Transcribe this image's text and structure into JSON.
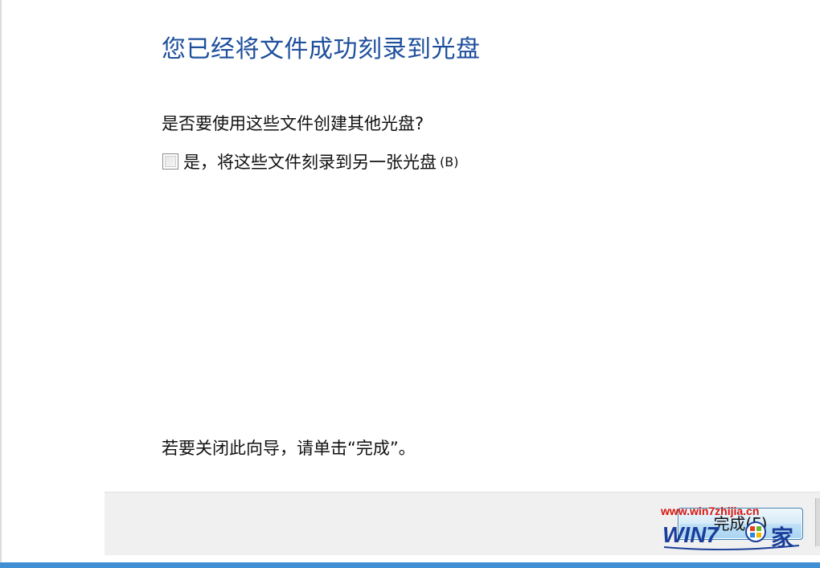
{
  "wizard": {
    "heading": "您已经将文件成功刻录到光盘",
    "question": "是否要使用这些文件创建其他光盘?",
    "checkbox": {
      "label": "是，将这些文件刻录到另一张光盘",
      "accelerator": "(B)",
      "checked": false
    },
    "close_hint": "若要关闭此向导，请单击“完成”。"
  },
  "footer": {
    "finish_label": "完成(F)"
  },
  "watermark": {
    "url": "www.win7zhijia.cn",
    "logo_text": "WIN7",
    "logo_suffix": "家"
  },
  "colors": {
    "heading": "#1e4f9c",
    "footer_bg": "#f0f0f0",
    "accent_bar": "#3f8fd2",
    "watermark_red": "#d9140c",
    "watermark_blue": "#1a3f9a"
  }
}
